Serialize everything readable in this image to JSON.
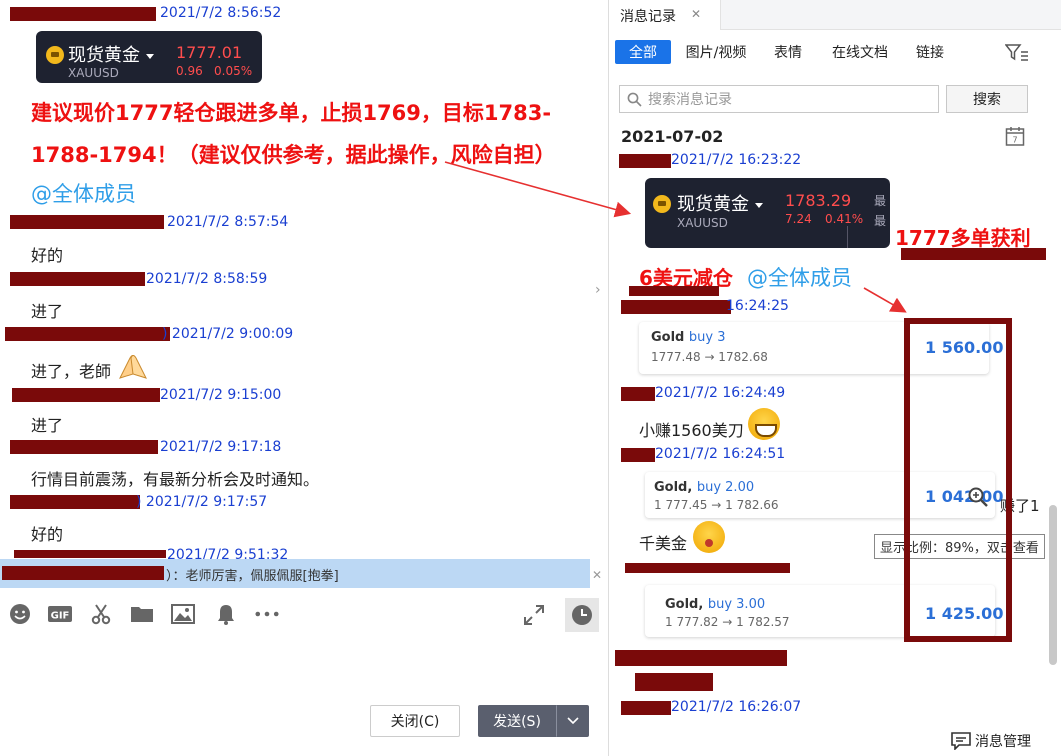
{
  "left": {
    "messages": [
      {
        "ts": "2021/7/2 8:56:52"
      },
      {
        "ts": "2021/7/2 8:57:54",
        "text": "好的"
      },
      {
        "ts": "2021/7/2 8:58:59",
        "text": "进了"
      },
      {
        "ts": ") 2021/7/2 9:00:09",
        "text": "进了，老師"
      },
      {
        "ts": "2021/7/2 9:15:00",
        "text": "进了"
      },
      {
        "ts": "2021/7/2 9:17:18",
        "text": "行情目前震荡，有最新分析会及时通知。"
      },
      {
        "ts": ") 2021/7/2 9:17:57",
        "text": "好的"
      },
      {
        "ts": "2021/7/2 9:51:32"
      }
    ],
    "gold_card": {
      "name": "现货黄金",
      "symbol": "XAUUSD",
      "price": "1777.01",
      "change": "0.96",
      "change_pct": "0.05%"
    },
    "advice_line1": "建议现价1777轻仓跟进多单，止损1769，目标1783-",
    "advice_line2": "1788-1794！（建议仅供参考，据此操作，风险自担）",
    "mention_all": "@全体成员",
    "quote_text": "）：老师厉害，佩服佩服[抱拳]",
    "close_label": "关闭(C)",
    "send_label": "发送(S)"
  },
  "right": {
    "tab_title": "消息记录",
    "filters": [
      "全部",
      "图片/视频",
      "表情",
      "在线文档",
      "链接"
    ],
    "search_placeholder": "搜索消息记录",
    "search_button": "搜索",
    "date_header": "2021-07-02",
    "entries": [
      {
        "ts": "2021/7/2 16:23:22"
      },
      {
        "ts": "16:24:25"
      },
      {
        "ts": "2021/7/2 16:24:49",
        "text": "小赚1560美刀"
      },
      {
        "ts": "2021/7/2 16:24:51"
      },
      {
        "text": "千美金"
      },
      {
        "ts": "2021/7/2 16:26:07"
      }
    ],
    "gold_card": {
      "name": "现货黄金",
      "symbol": "XAUUSD",
      "price": "1783.29",
      "change": "7.24",
      "change_pct": "0.41%",
      "cut1": "最",
      "cut2": "最"
    },
    "trades": [
      {
        "label": "Gold",
        "side": "buy 3",
        "route": "1777.48 → 1782.68",
        "amount": "1 560.00"
      },
      {
        "label": "Gold,",
        "side": "buy 2.00",
        "route": "1 777.45 → 1 782.66",
        "amount": "1 042.00"
      },
      {
        "label": "Gold,",
        "side": "buy 3.00",
        "route": "1 777.82 → 1 782.57",
        "amount": "1 425.00"
      }
    ],
    "profit_label": "1777多单获利",
    "reduce_label": "6美元减仓",
    "mention_all": "@全体成员",
    "side_text": "赚了1",
    "tooltip": "显示比例：89%，双击查看",
    "manage_label": "消息管理"
  },
  "colors": {
    "accent": "#1a73e8",
    "redaction": "#7a0a0a",
    "timestamp": "#1a3fd1",
    "alert_red": "#ee1111"
  }
}
